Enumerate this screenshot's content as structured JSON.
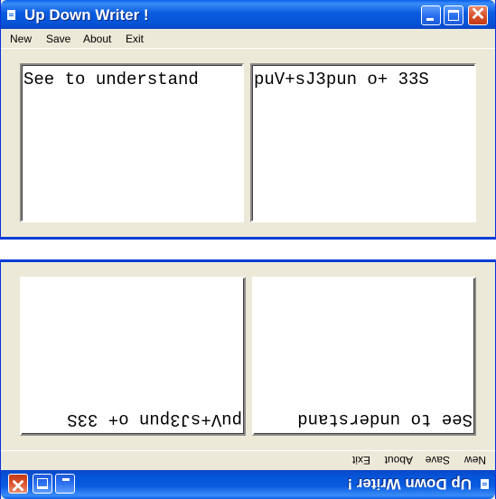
{
  "windows": [
    {
      "title": "Up Down Writer !",
      "menu": [
        "New",
        "Save",
        "About",
        "Exit"
      ],
      "left_text": "See to understand",
      "right_text": "puV+sJ3pun o+ 33S"
    },
    {
      "title": "Up Down Writer !",
      "menu": [
        "New",
        "Save",
        "About",
        "Exit"
      ],
      "left_text": "See to understand",
      "right_text": "puV+sJ3pun o+ 33S"
    }
  ],
  "icons": {
    "app": "window-app-icon",
    "minimize": "minimize-icon",
    "maximize": "maximize-icon",
    "close": "close-icon"
  },
  "colors": {
    "titlebar": "#0a5ce0",
    "close_button": "#d9502a",
    "window_face": "#ece9d8"
  }
}
